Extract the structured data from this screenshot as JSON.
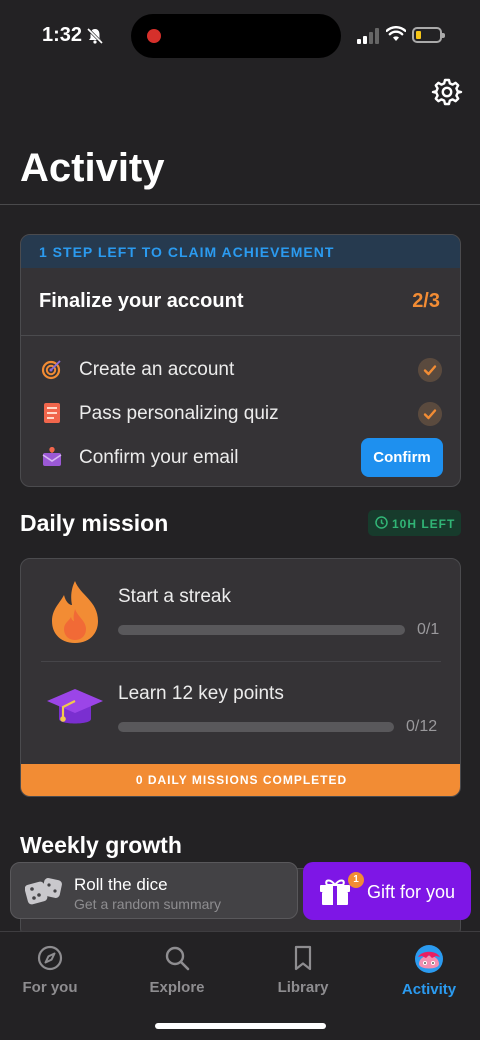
{
  "status_bar": {
    "time": "1:32",
    "icons": [
      "bell-slash-icon",
      "recording-dot-icon",
      "signal-icon",
      "wifi-icon",
      "battery-icon"
    ]
  },
  "header": {
    "settings_icon": "gear-icon",
    "title": "Activity"
  },
  "achievement": {
    "banner": "1 STEP LEFT TO CLAIM ACHIEVEMENT",
    "title": "Finalize your account",
    "progress": "2/3",
    "tasks": [
      {
        "label": "Create an account",
        "icon": "target-icon",
        "done": true
      },
      {
        "label": "Pass personalizing quiz",
        "icon": "quiz-icon",
        "done": true
      },
      {
        "label": "Confirm your email",
        "icon": "envelope-icon",
        "done": false,
        "action": "Confirm"
      }
    ]
  },
  "daily_mission": {
    "title": "Daily mission",
    "time_left": "10H LEFT",
    "missions": [
      {
        "label": "Start a streak",
        "icon": "flame-icon",
        "count": "0/1",
        "progress": 0
      },
      {
        "label": "Learn 12 key points",
        "icon": "graduation-cap-icon",
        "count": "0/12",
        "progress": 0
      }
    ],
    "footer": "0 DAILY MISSIONS COMPLETED"
  },
  "weekly_growth": {
    "title": "Weekly growth"
  },
  "floating": {
    "dice": {
      "title": "Roll the dice",
      "subtitle": "Get a random summary"
    },
    "gift": {
      "label": "Gift for you",
      "badge": "1"
    }
  },
  "tabs": [
    {
      "label": "For you",
      "icon": "compass-icon",
      "active": false
    },
    {
      "label": "Explore",
      "icon": "search-icon",
      "active": false
    },
    {
      "label": "Library",
      "icon": "bookmark-icon",
      "active": false
    },
    {
      "label": "Activity",
      "icon": "avatar-icon",
      "active": true
    }
  ],
  "colors": {
    "accent_blue": "#2b9bf0",
    "accent_orange": "#f28c34",
    "gift_purple": "#7e16e6",
    "success_green": "#31b576"
  }
}
